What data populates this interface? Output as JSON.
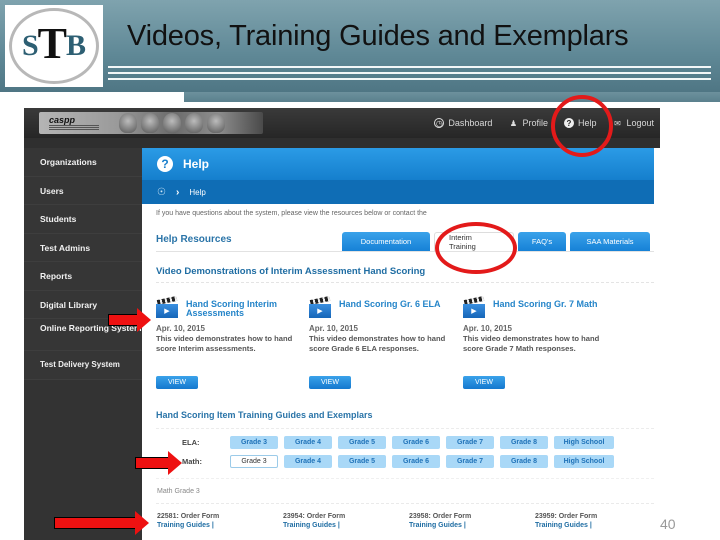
{
  "slide": {
    "title": "Videos, Training Guides and Exemplars",
    "logo_text": {
      "s": "S",
      "t": "T",
      "b": "B"
    },
    "page_number": "40"
  },
  "app": {
    "brand_name": "caspp",
    "top_nav": [
      {
        "label": "Dashboard",
        "icon": "dashboard-icon"
      },
      {
        "label": "Profile",
        "icon": "profile-icon"
      },
      {
        "label": "Help",
        "icon": "help-icon"
      },
      {
        "label": "Logout",
        "icon": "logout-icon"
      }
    ],
    "sidebar": [
      {
        "label": "Organizations"
      },
      {
        "label": "Users"
      },
      {
        "label": "Students"
      },
      {
        "label": "Test Admins"
      },
      {
        "label": "Reports"
      },
      {
        "label": "Digital Library"
      },
      {
        "label": "Online Reporting System"
      },
      {
        "label": "Test Delivery System"
      }
    ],
    "header": {
      "icon": "?",
      "title": "Help"
    },
    "breadcrumb": {
      "home_icon": "home-icon",
      "separator": "›",
      "current": "Help"
    },
    "intro_text": "If you have questions about the system, please view the resources below or contact the",
    "resources_title": "Help Resources",
    "tabs": [
      {
        "label": "Documentation",
        "active": false
      },
      {
        "label": "Interim Training",
        "active": true
      },
      {
        "label": "FAQ's",
        "active": false
      },
      {
        "label": "SAA Materials",
        "active": false
      }
    ],
    "video_section_title": "Video Demonstrations of Interim Assessment Hand Scoring",
    "videos": [
      {
        "title": "Hand Scoring Interim Assessments",
        "date": "Apr. 10, 2015",
        "description": "This video demonstrates how to hand score Interim assessments.",
        "button": "VIEW"
      },
      {
        "title": "Hand Scoring Gr. 6 ELA",
        "date": "Apr. 10, 2015",
        "description": "This video demonstrates how to hand score Grade 6 ELA responses.",
        "button": "VIEW"
      },
      {
        "title": "Hand Scoring Gr. 7 Math",
        "date": "Apr. 10, 2015",
        "description": "This video demonstrates how to hand score Grade 7 Math responses.",
        "button": "VIEW"
      }
    ],
    "guides_title": "Hand Scoring Item Training Guides and Exemplars",
    "ela": {
      "label": "ELA:",
      "grades": [
        "Grade 3",
        "Grade 4",
        "Grade 5",
        "Grade 6",
        "Grade 7",
        "Grade 8",
        "High School"
      ]
    },
    "math": {
      "label": "Math:",
      "selected": "Grade 3",
      "grades": [
        "Grade 3",
        "Grade 4",
        "Grade 5",
        "Grade 6",
        "Grade 7",
        "Grade 8",
        "High School"
      ]
    },
    "math_grade_label": "Math Grade 3",
    "forms": [
      {
        "id": "22581: Order Form",
        "link": "Training Guides |"
      },
      {
        "id": "23954: Order Form",
        "link": "Training Guides |"
      },
      {
        "id": "23958: Order Form",
        "link": "Training Guides |"
      },
      {
        "id": "23959: Order Form",
        "link": "Training Guides |"
      }
    ]
  },
  "colors": {
    "header_teal": "#5f8896",
    "app_blue": "#1681d6",
    "sidebar_dark": "#333333",
    "annotation_red": "#e31a1a",
    "link_blue": "#1f6da3"
  }
}
